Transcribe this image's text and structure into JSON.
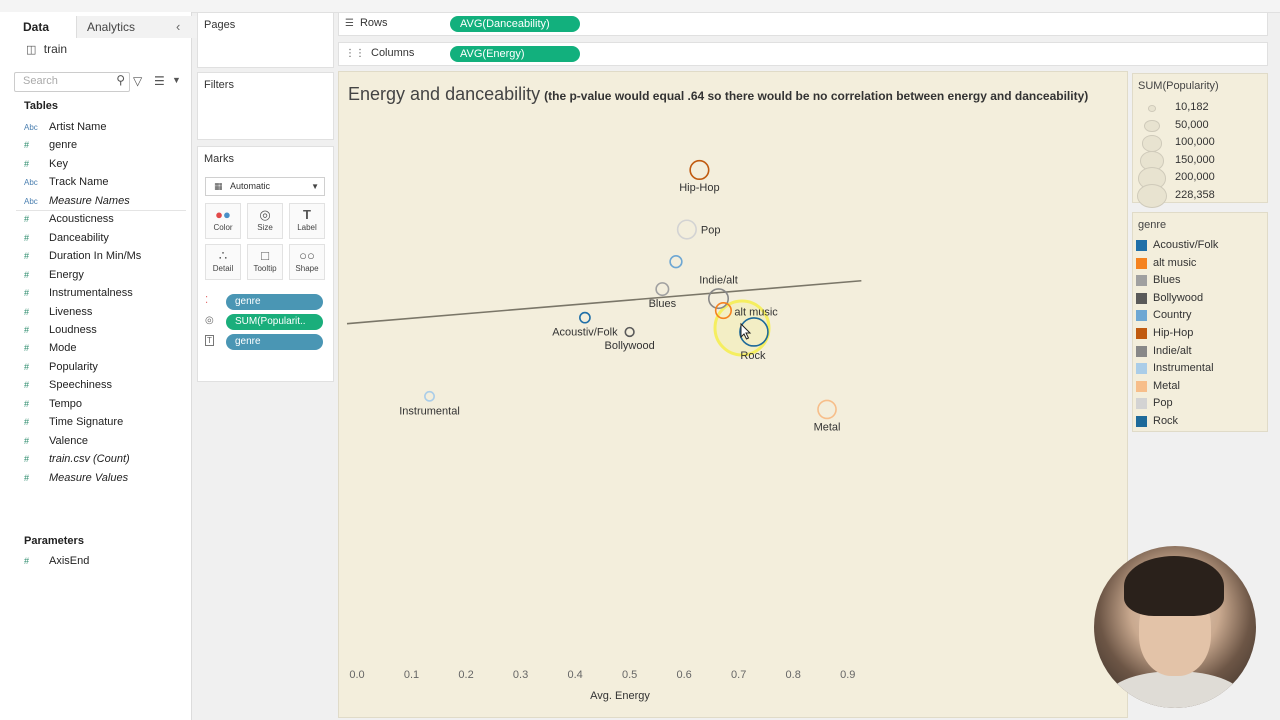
{
  "left_pane": {
    "tabs": [
      "Data",
      "Analytics"
    ],
    "collapse_glyph": "‹",
    "datasource": "train",
    "search_placeholder": "Search",
    "tables_heading": "Tables",
    "fields": [
      {
        "type": "Abc",
        "name": "Artist Name",
        "italic": false
      },
      {
        "type": "#",
        "name": "genre",
        "italic": false
      },
      {
        "type": "#",
        "name": "Key",
        "italic": false
      },
      {
        "type": "Abc",
        "name": "Track Name",
        "italic": false
      },
      {
        "type": "Abc",
        "name": "Measure Names",
        "italic": true
      },
      {
        "type": "#",
        "name": "Acousticness",
        "italic": false
      },
      {
        "type": "#",
        "name": "Danceability",
        "italic": false
      },
      {
        "type": "#",
        "name": "Duration In Min/Ms",
        "italic": false
      },
      {
        "type": "#",
        "name": "Energy",
        "italic": false
      },
      {
        "type": "#",
        "name": "Instrumentalness",
        "italic": false
      },
      {
        "type": "#",
        "name": "Liveness",
        "italic": false
      },
      {
        "type": "#",
        "name": "Loudness",
        "italic": false
      },
      {
        "type": "#",
        "name": "Mode",
        "italic": false
      },
      {
        "type": "#",
        "name": "Popularity",
        "italic": false
      },
      {
        "type": "#",
        "name": "Speechiness",
        "italic": false
      },
      {
        "type": "#",
        "name": "Tempo",
        "italic": false
      },
      {
        "type": "#",
        "name": "Time Signature",
        "italic": false
      },
      {
        "type": "#",
        "name": "Valence",
        "italic": false
      },
      {
        "type": "#",
        "name": "train.csv (Count)",
        "italic": true
      },
      {
        "type": "#",
        "name": "Measure Values",
        "italic": true
      }
    ],
    "parameters_heading": "Parameters",
    "parameters": [
      {
        "type": "#",
        "name": "AxisEnd"
      }
    ]
  },
  "cards": {
    "pages": "Pages",
    "filters": "Filters",
    "marks": "Marks",
    "mark_type": "Automatic",
    "mark_buttons": [
      "Color",
      "Size",
      "Label",
      "Detail",
      "Tooltip",
      "Shape"
    ],
    "mark_pills": [
      {
        "icon": "color-dots",
        "label": "genre",
        "style": "blue"
      },
      {
        "icon": "size-circles",
        "label": "SUM(Popularit..",
        "style": "green"
      },
      {
        "icon": "label-T",
        "label": "genre",
        "style": "blue"
      }
    ]
  },
  "shelves": {
    "rows_label": "Rows",
    "rows_pill": "AVG(Danceability)",
    "columns_label": "Columns",
    "columns_pill": "AVG(Energy)"
  },
  "viz": {
    "title": "Energy and danceability",
    "subtitle": "(the p-value would equal .64 so there would be no correlation between energy and danceability)"
  },
  "chart_data": {
    "type": "scatter",
    "xlabel": "Avg. Energy",
    "ylabel": "",
    "xlim": [
      0.0,
      0.95
    ],
    "ylim": [
      0.285,
      0.75
    ],
    "x_ticks": [
      "0.0",
      "0.1",
      "0.2",
      "0.3",
      "0.4",
      "0.5",
      "0.6",
      "0.7",
      "0.8",
      "0.9"
    ],
    "size_measure": "SUM(Popularity)",
    "color_field": "genre",
    "points": [
      {
        "genre": "Hip-Hop",
        "x": 0.628,
        "y": 0.698,
        "popularity": 100000
      },
      {
        "genre": "Pop",
        "x": 0.605,
        "y": 0.648,
        "popularity": 100000
      },
      {
        "genre": "Country",
        "x": 0.585,
        "y": 0.621,
        "popularity": 40000
      },
      {
        "genre": "Indie/alt",
        "x": 0.663,
        "y": 0.59,
        "popularity": 110000
      },
      {
        "genre": "Blues",
        "x": 0.56,
        "y": 0.598,
        "popularity": 45000
      },
      {
        "genre": "alt music",
        "x": 0.672,
        "y": 0.58,
        "popularity": 70000
      },
      {
        "genre": "Acoustiv/Folk",
        "x": 0.418,
        "y": 0.574,
        "popularity": 30000
      },
      {
        "genre": "Bollywood",
        "x": 0.5,
        "y": 0.562,
        "popularity": 22000
      },
      {
        "genre": "Rock",
        "x": 0.728,
        "y": 0.562,
        "popularity": 228358
      },
      {
        "genre": "Instrumental",
        "x": 0.133,
        "y": 0.508,
        "popularity": 25000
      },
      {
        "genre": "Metal",
        "x": 0.862,
        "y": 0.497,
        "popularity": 95000
      }
    ],
    "trend_line": {
      "x": [
        0.0,
        0.925
      ],
      "y": [
        0.569,
        0.605
      ]
    }
  },
  "size_legend": {
    "title": "SUM(Popularity)",
    "entries": [
      {
        "label": "10,182",
        "value": 10182
      },
      {
        "label": "50,000",
        "value": 50000
      },
      {
        "label": "100,000",
        "value": 100000
      },
      {
        "label": "150,000",
        "value": 150000
      },
      {
        "label": "200,000",
        "value": 200000
      },
      {
        "label": "228,358",
        "value": 228358
      }
    ]
  },
  "color_legend": {
    "title": "genre",
    "entries": [
      {
        "label": "Acoustiv/Folk",
        "color": "#1f6fa8"
      },
      {
        "label": "alt music",
        "color": "#f5821f"
      },
      {
        "label": "Blues",
        "color": "#a0a0a0"
      },
      {
        "label": "Bollywood",
        "color": "#5a5a5a"
      },
      {
        "label": "Country",
        "color": "#6ea7d3"
      },
      {
        "label": "Hip-Hop",
        "color": "#c05a10"
      },
      {
        "label": "Indie/alt",
        "color": "#888888"
      },
      {
        "label": "Instrumental",
        "color": "#aacde8"
      },
      {
        "label": "Metal",
        "color": "#f7be8a"
      },
      {
        "label": "Pop",
        "color": "#d3d3d3"
      },
      {
        "label": "Rock",
        "color": "#1e6a9a"
      }
    ]
  },
  "cursor_highlight_color": "#f5ee60"
}
